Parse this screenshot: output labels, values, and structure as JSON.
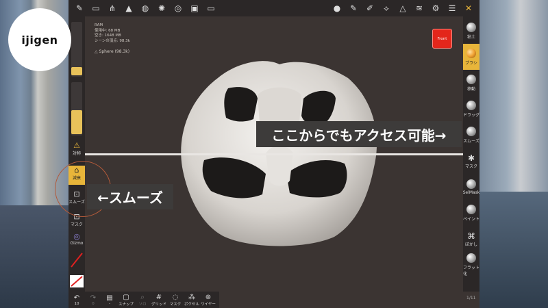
{
  "logo": {
    "text": "ijigen"
  },
  "info": {
    "ram_title": "RAM",
    "ram_used": "使用中: 68 MB",
    "ram_free": "空き: 1648 MB",
    "scene_vertices": "シーンの頂点: 98.3k",
    "object": "Sphere (98.3k)"
  },
  "top_toolbar": {
    "left_icons": [
      "logo-icon",
      "folder-icon",
      "scene-graph-icon",
      "topology-icon",
      "globe-icon",
      "sun-icon",
      "material-icon",
      "image-icon",
      "video-icon"
    ],
    "right_icons": [
      "matcap-icon",
      "pen-icon",
      "picker-icon",
      "symmetry-icon",
      "triangle-icon",
      "layers-icon",
      "settings-icon",
      "menu-icon",
      "tools-icon"
    ]
  },
  "left_panel": {
    "radius_slider": 0.15,
    "intensity_slider": 0.45,
    "symmetry_label": "対称",
    "falloff_label": "減衰",
    "smooth_label": "スムーズ",
    "mask_label": "マスク",
    "gizmo_label": "Gizmo"
  },
  "front_button": {
    "label": "Front"
  },
  "right_panel": {
    "tools": [
      {
        "label": "粘土",
        "icon": "clay-sphere-icon"
      },
      {
        "label": "ブラシ",
        "icon": "brush-sphere-icon",
        "active": true
      },
      {
        "label": "移動",
        "icon": "move-sphere-icon"
      },
      {
        "label": "ドラッグ",
        "icon": "drag-sphere-icon"
      },
      {
        "label": "スムーズ",
        "icon": "smooth-sphere-icon"
      },
      {
        "label": "マスク",
        "icon": "mask-icon"
      },
      {
        "label": "SelMask",
        "icon": "selmask-sphere-icon"
      },
      {
        "label": "ペイント",
        "icon": "paint-sphere-icon"
      },
      {
        "label": "ぼかし",
        "icon": "blur-icon"
      },
      {
        "label": "フラット化",
        "icon": "flatten-sphere-icon"
      }
    ],
    "page": "1/11"
  },
  "bottom_toolbar": {
    "items": [
      {
        "label": "10",
        "icon": "undo-icon"
      },
      {
        "label": "0",
        "icon": "redo-icon"
      },
      {
        "label": "-",
        "icon": "file-icon"
      },
      {
        "label": "スナップ",
        "icon": "camera-icon"
      },
      {
        "label": "ソロ",
        "icon": "solo-icon"
      },
      {
        "label": "グリッド",
        "icon": "grid-icon"
      },
      {
        "label": "マスク",
        "icon": "eye-mask-icon"
      },
      {
        "label": "ボクセル",
        "icon": "voxel-icon"
      },
      {
        "label": "ワイヤー",
        "icon": "wireframe-icon"
      }
    ]
  },
  "callouts": {
    "right": "ここからでもアクセス可能→",
    "left": "←スムーズ"
  }
}
